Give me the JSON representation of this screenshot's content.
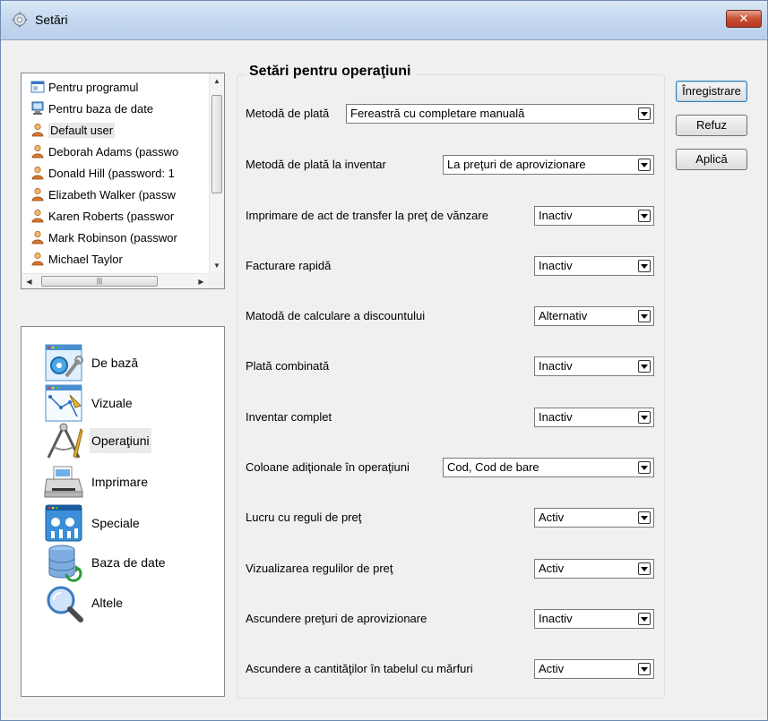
{
  "window": {
    "title": "Setări",
    "close_label": "✕"
  },
  "users": {
    "items": [
      {
        "label": "Pentru programul",
        "icon": "program-icon"
      },
      {
        "label": "Pentru baza de date",
        "icon": "database-computer-icon"
      },
      {
        "label": "Default user",
        "icon": "user-icon"
      },
      {
        "label": "Deborah Adams (passwo",
        "icon": "user-icon"
      },
      {
        "label": "Donald Hill (password: 1",
        "icon": "user-icon"
      },
      {
        "label": "Elizabeth Walker (passw",
        "icon": "user-icon"
      },
      {
        "label": "Karen Roberts (passwor",
        "icon": "user-icon"
      },
      {
        "label": "Mark Robinson (passwor",
        "icon": "user-icon"
      },
      {
        "label": "Michael Taylor",
        "icon": "user-icon"
      }
    ],
    "selected_index": 2
  },
  "categories": {
    "items": [
      {
        "label": "De bază",
        "icon": "basic-settings-icon"
      },
      {
        "label": "Vizuale",
        "icon": "visual-icon"
      },
      {
        "label": "Operaţiuni",
        "icon": "compass-icon"
      },
      {
        "label": "Imprimare",
        "icon": "printer-icon"
      },
      {
        "label": "Speciale",
        "icon": "special-icon"
      },
      {
        "label": "Baza de date",
        "icon": "database-icon"
      },
      {
        "label": "Altele",
        "icon": "magnifier-icon"
      }
    ],
    "selected_index": 2
  },
  "settings": {
    "title": "Setări pentru operaţiuni",
    "rows": [
      {
        "label": "Metodă de plată",
        "value": "Fereastră cu completare manuală"
      },
      {
        "label": "Metodă de plată la inventar",
        "value": "La preţuri de aprovizionare"
      },
      {
        "label": "Imprimare de act de transfer la preţ de vănzare",
        "value": "Inactiv"
      },
      {
        "label": "Facturare rapidă",
        "value": "Inactiv"
      },
      {
        "label": "Matodă de calculare a discountului",
        "value": "Alternativ"
      },
      {
        "label": "Plată combinată",
        "value": "Inactiv"
      },
      {
        "label": "Inventar complet",
        "value": "Inactiv"
      },
      {
        "label": "Coloane adiţionale în operaţiuni",
        "value": "Cod, Cod de bare"
      },
      {
        "label": "Lucru cu reguli de preţ",
        "value": "Activ"
      },
      {
        "label": "Vizualizarea regulilor de preţ",
        "value": "Activ"
      },
      {
        "label": "Ascundere preţuri de aprovizionare",
        "value": "Inactiv"
      },
      {
        "label": "Ascundere a cantităţilor în tabelul cu mărfuri",
        "value": "Activ"
      }
    ]
  },
  "buttons": {
    "save": "Înregistrare",
    "cancel": "Refuz",
    "apply": "Aplică"
  }
}
